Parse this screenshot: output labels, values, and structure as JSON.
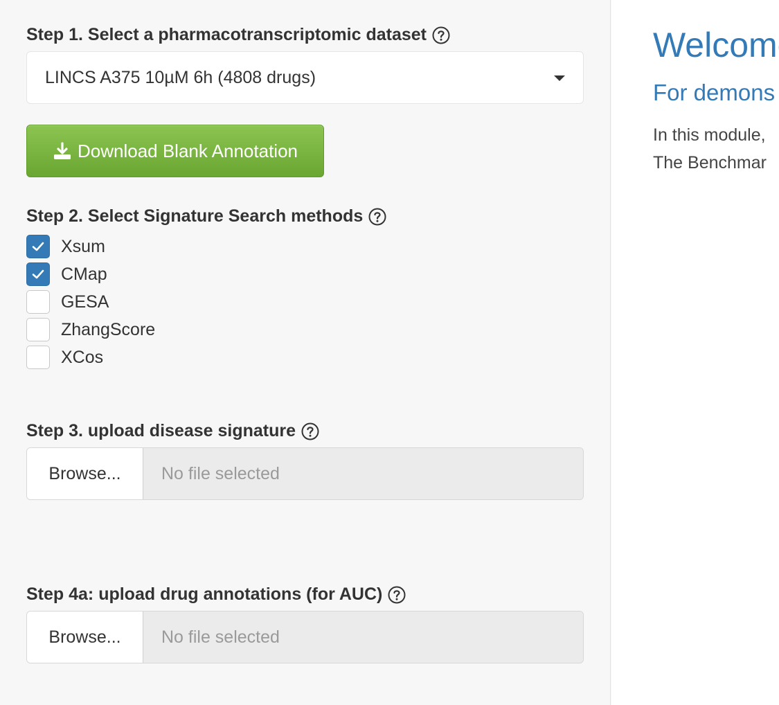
{
  "sidebar": {
    "step1": {
      "label": "Step 1. Select a pharmacotranscriptomic dataset",
      "selected_value": "LINCS A375 10µM 6h (4808 drugs)"
    },
    "download_button": {
      "label": "Download Blank Annotation",
      "icon": "download-icon",
      "color": "#6fad35"
    },
    "step2": {
      "label": "Step 2. Select Signature Search methods",
      "methods": [
        {
          "label": "Xsum",
          "checked": true
        },
        {
          "label": "CMap",
          "checked": true
        },
        {
          "label": "GESA",
          "checked": false
        },
        {
          "label": "ZhangScore",
          "checked": false
        },
        {
          "label": "XCos",
          "checked": false
        }
      ]
    },
    "step3": {
      "label": "Step 3. upload disease signature",
      "browse_label": "Browse...",
      "file_status": "No file selected"
    },
    "step4a": {
      "label": "Step 4a: upload drug annotations (for AUC)",
      "browse_label": "Browse...",
      "file_status": "No file selected"
    }
  },
  "main": {
    "title": "Welcome",
    "subtitle": "For demons",
    "text_lines": [
      "In this module,",
      "The Benchmar"
    ]
  },
  "colors": {
    "accent": "#337ab7",
    "checkbox_checked": "#337ab7",
    "button_green": "#6fad35"
  }
}
